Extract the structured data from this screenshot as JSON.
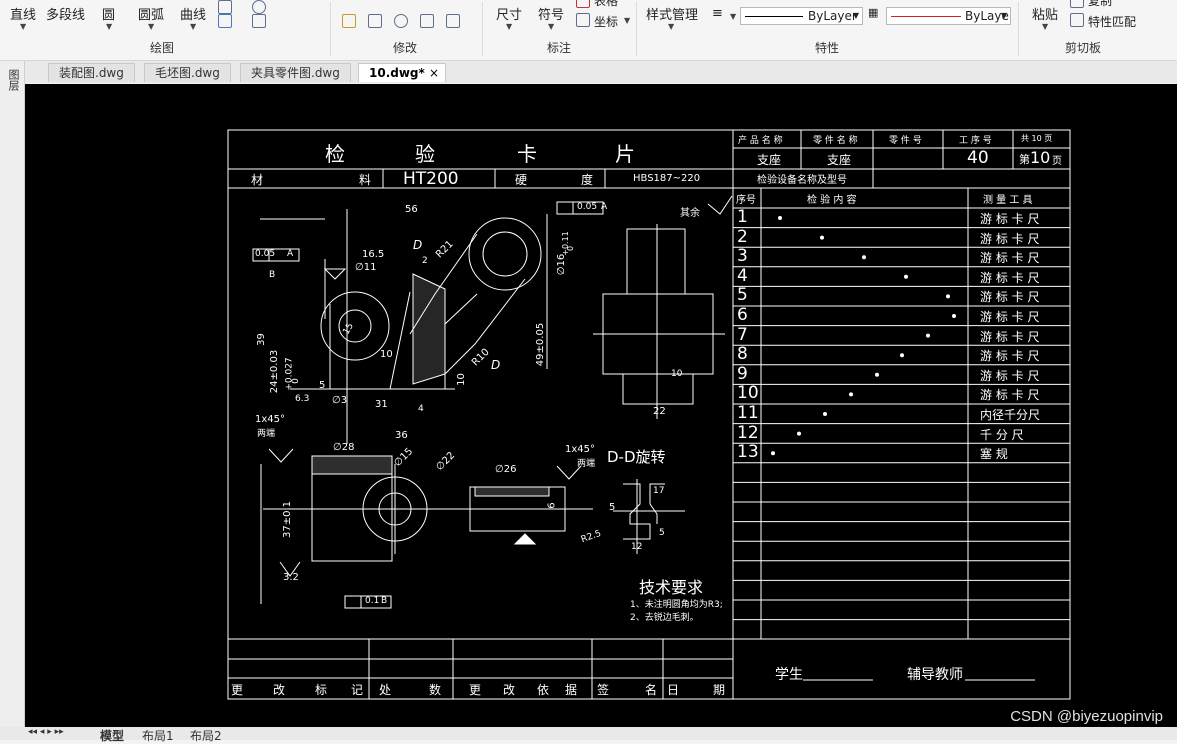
{
  "ribbon": {
    "draw": {
      "line": "直线",
      "polyline": "多段线",
      "circle": "圆",
      "arc": "圆弧",
      "curve": "曲线",
      "label": "绘图"
    },
    "modify": {
      "label": "修改"
    },
    "annotate": {
      "dim": "尺寸",
      "symbol": "符号",
      "table": "表格",
      "coord": "坐标",
      "label": "标注"
    },
    "props": {
      "style_mgr": "样式管理",
      "layer1": "ByLayer",
      "layer2": "ByLaye",
      "label": "特性"
    },
    "clipboard": {
      "paste": "粘贴",
      "copy": "复制",
      "match": "特性匹配",
      "label": "剪切板"
    }
  },
  "tabs": [
    "装配图.dwg",
    "毛坯图.dwg",
    "夹具零件图.dwg",
    "10.dwg*"
  ],
  "left_tool": "图层",
  "bottom_tabs": [
    "模型",
    "布局1",
    "布局2"
  ],
  "card": {
    "title": [
      "检",
      "验",
      "卡",
      "片"
    ],
    "material_label": [
      "材",
      "料"
    ],
    "material": "HT200",
    "hardness_label": [
      "硬",
      "度"
    ],
    "hardness": "HBS187~220",
    "hdr": {
      "product": "产 品 名 称",
      "part": "零 件 名 称",
      "partno": "零 件 号",
      "proc": "工 序 号",
      "total": "共 10 页"
    },
    "vals": {
      "product": "支座",
      "part": "支座",
      "proc": "40",
      "page_pre": "第",
      "page": "10",
      "page_suf": "页"
    },
    "equip": "检验设备名称及型号",
    "list_hdr": {
      "no": "序号",
      "content": "检    验    内    容",
      "tool": "测  量  工  具"
    },
    "rows": [
      {
        "no": "1",
        "tool": "游 标 卡 尺"
      },
      {
        "no": "2",
        "tool": "游 标 卡 尺"
      },
      {
        "no": "3",
        "tool": "游 标 卡 尺"
      },
      {
        "no": "4",
        "tool": "游 标 卡 尺"
      },
      {
        "no": "5",
        "tool": "游 标 卡 尺"
      },
      {
        "no": "6",
        "tool": "游 标 卡 尺"
      },
      {
        "no": "7",
        "tool": "游 标 卡 尺"
      },
      {
        "no": "8",
        "tool": "游 标 卡 尺"
      },
      {
        "no": "9",
        "tool": "游 标 卡 尺"
      },
      {
        "no": "10",
        "tool": "游 标 卡 尺"
      },
      {
        "no": "11",
        "tool": "内径千分尺"
      },
      {
        "no": "12",
        "tool": "千  分  尺"
      },
      {
        "no": "13",
        "tool": "塞   规"
      }
    ],
    "bottom_cells": [
      "更",
      "改",
      "标",
      "记",
      "处",
      "数",
      "更",
      "改",
      "依",
      "据",
      "签",
      "名",
      "日",
      "期"
    ],
    "student": "学生",
    "teacher": "辅导教师",
    "tech_title": "技术要求",
    "tech1": "1、未注明圆角均为R3;",
    "tech2": "2、去锐边毛刺。",
    "section": "D-D旋转",
    "rest": "其余",
    "dims": {
      "d56": "56",
      "d165": "16.5",
      "d11": "∅11",
      "d39": "39",
      "d24": "24±0.03",
      "d027": "+0.027",
      "d0": "0",
      "d49": "49±0.05",
      "d16": "∅16",
      "d16t": "+0.11",
      "d16b": "0",
      "r21": "R21",
      "r10": "R10",
      "d3": "∅3",
      "d31": "31",
      "d36": "36",
      "d5": "5",
      "d10": "10",
      "d10b": "10",
      "d22": "22",
      "d28": "∅28",
      "d15": "∅15",
      "d22b": "∅22",
      "d26": "∅26",
      "d37": "37±0.1",
      "d32": "3.2",
      "d6": "6",
      "d17": "17",
      "d5b": "5",
      "d12": "12",
      "r25": "R2.5",
      "d5c": "5",
      "dD": "D",
      "dD2": "D",
      "tol1": "0.05",
      "tolA": "A",
      "tol2": "0.05",
      "tol2A": "A",
      "tol3": "0.1",
      "tol3B": "B",
      "ch1": "1x45°",
      "ch1b": "两端",
      "ch2": "1x45°",
      "ch2b": "两端",
      "c2": "2",
      "c4": "4",
      "cB": "B",
      "c63": "6.3",
      "c15": "15",
      "c10": "10"
    }
  },
  "watermark": "CSDN @biyezuopinvip"
}
